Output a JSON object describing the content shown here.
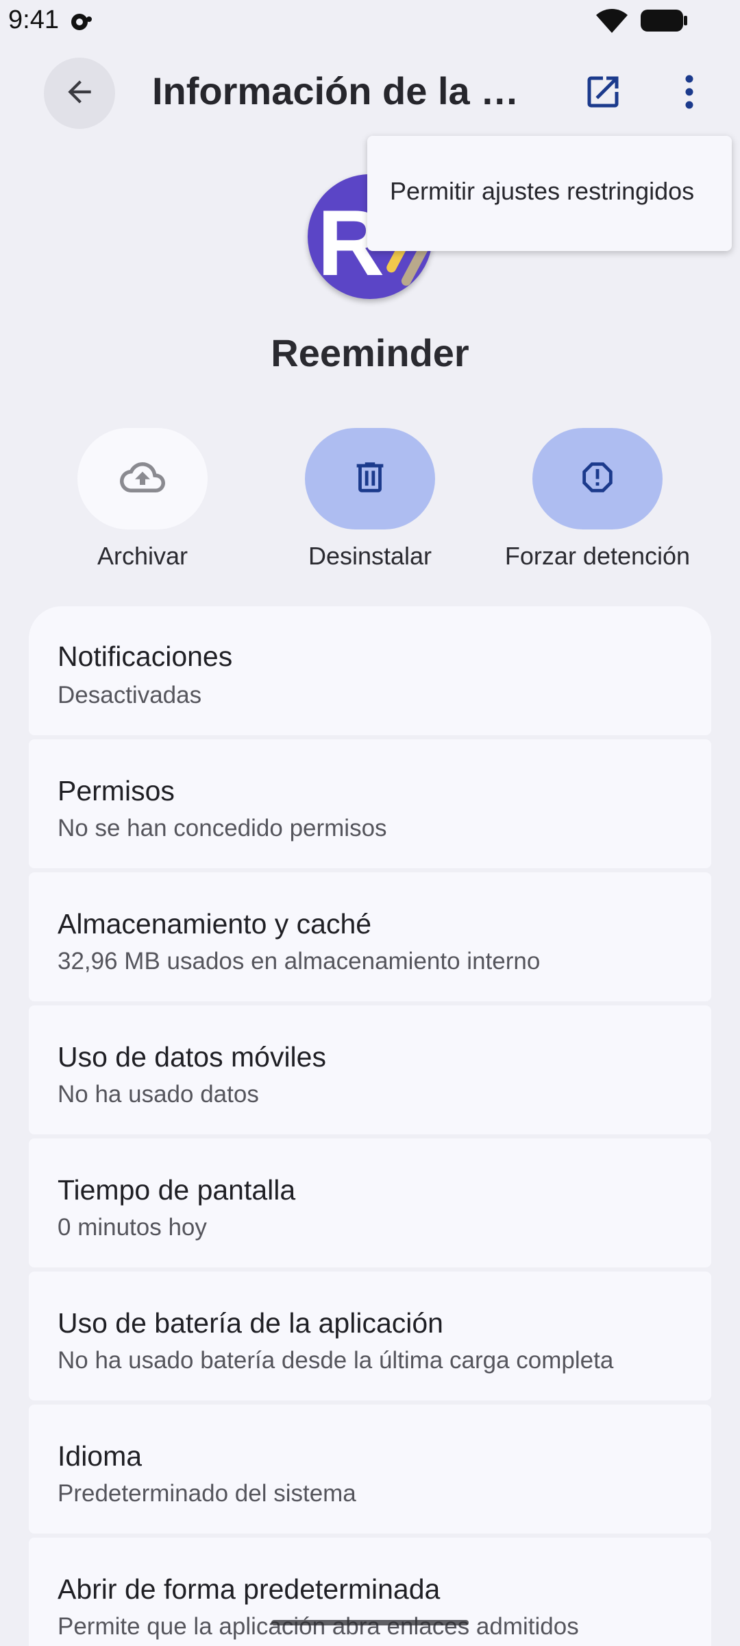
{
  "status_bar": {
    "time": "9:41"
  },
  "header": {
    "title": "Información de la aplicación"
  },
  "menu": {
    "items": [
      {
        "label": "Permitir ajustes restringidos"
      }
    ]
  },
  "app": {
    "name": "Reeminder",
    "icon_letter": "R"
  },
  "actions": [
    {
      "label": "Archivar",
      "icon": "cloud-upload-icon"
    },
    {
      "label": "Desinstalar",
      "icon": "trash-icon"
    },
    {
      "label": "Forzar detención",
      "icon": "alert-octagon-icon"
    }
  ],
  "settings": [
    {
      "title": "Notificaciones",
      "subtitle": "Desactivadas"
    },
    {
      "title": "Permisos",
      "subtitle": "No se han concedido permisos"
    },
    {
      "title": "Almacenamiento y caché",
      "subtitle": "32,96 MB usados en almacenamiento interno"
    },
    {
      "title": "Uso de datos móviles",
      "subtitle": "No ha usado datos"
    },
    {
      "title": "Tiempo de pantalla",
      "subtitle": "0 minutos hoy"
    },
    {
      "title": "Uso de batería de la aplicación",
      "subtitle": "No ha usado batería desde la última carga completa"
    },
    {
      "title": "Idioma",
      "subtitle": "Predeterminado del sistema"
    },
    {
      "title": "Abrir de forma predeterminada",
      "subtitle": "Permite que la aplicación abra enlaces admitidos"
    }
  ],
  "colors": {
    "background": "#efeff5",
    "card": "#f8f8fd",
    "accent_pill": "#aebdf1",
    "icon_blue": "#1b3a8c",
    "app_icon": "#5b45c6"
  }
}
